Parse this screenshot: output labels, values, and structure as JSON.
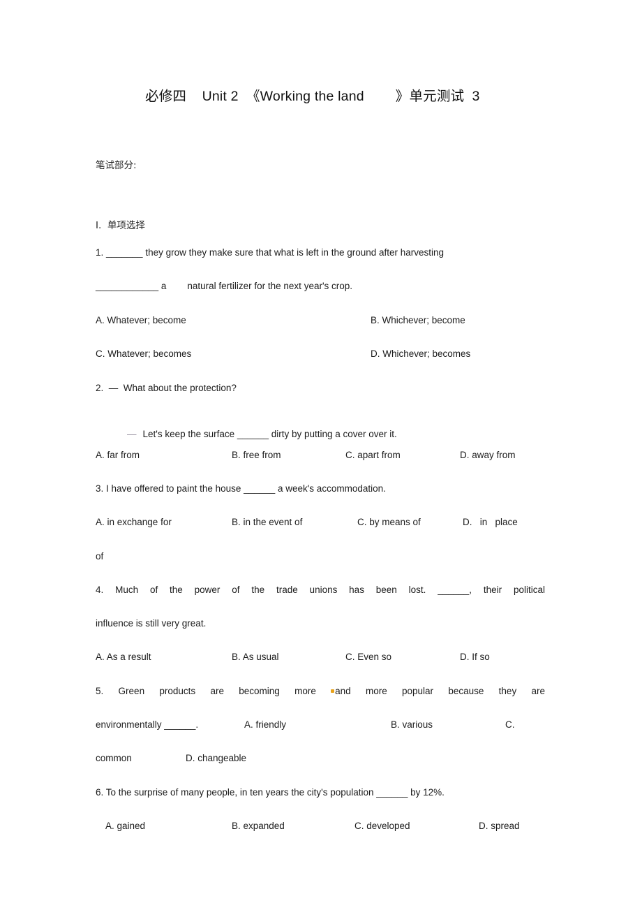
{
  "document": {
    "title": "必修四    Unit 2  《Working the land        》单元测试  3",
    "section_label": "笔试部分:",
    "part_heading": "I.  单项选择"
  },
  "questions": [
    {
      "number": "1",
      "stem_line_1": "1. _______ they grow they make sure that what is left in the ground after harvesting",
      "stem_line_2": "____________ a        natural fertilizer for the next year's crop.",
      "options_row_1": [
        "A. Whatever; become",
        "B. Whichever; become"
      ],
      "options_row_2": [
        "C. Whatever; becomes",
        "D. Whichever; becomes"
      ]
    },
    {
      "number": "2",
      "stem_line_1": "2.  —  What about the protection?",
      "dash": "—",
      "stem_line_2": "Let's keep the surface ______ dirty by putting a cover over it.",
      "options": [
        "A. far from",
        "B. free from",
        "C. apart from",
        "D. away from"
      ]
    },
    {
      "number": "3",
      "stem_line_1": "3. I have offered to paint the house ______ a week's accommodation.",
      "options": [
        "A. in exchange for",
        "B. in the event of",
        "C. by means of",
        "D.   in   place"
      ],
      "option_wrap": "of"
    },
    {
      "number": "4",
      "stem_line_1": "4. Much  of  the  power  of  the  trade  unions  has  been  lost.  ______, their  political",
      "stem_line_2": "influence is still very great.",
      "options": [
        "A. As a result",
        "B. As usual",
        "C. Even so",
        "D. If so"
      ]
    },
    {
      "number": "5",
      "stem_line_1_a": "5.  Green  products  are  becoming  more",
      "stem_line_1_b": "and  more  popular  because  they  are",
      "stem_line_2": "environmentally ______.",
      "inline_options": [
        "A. friendly",
        "B. various",
        "C."
      ],
      "wrap_line": "common",
      "wrap_option": "D. changeable"
    },
    {
      "number": "6",
      "stem_line_1": "6. To the surprise of many people, in ten years the city's population ______ by 12%.",
      "options": [
        "A. gained",
        "B. expanded",
        "C. developed",
        "D. spread"
      ]
    }
  ],
  "colors": {
    "text": "#1b1b1b",
    "title": "#111111",
    "dash_accent": "#9a93a3",
    "mark_accent": "#e8a21a",
    "background": "#ffffff"
  }
}
